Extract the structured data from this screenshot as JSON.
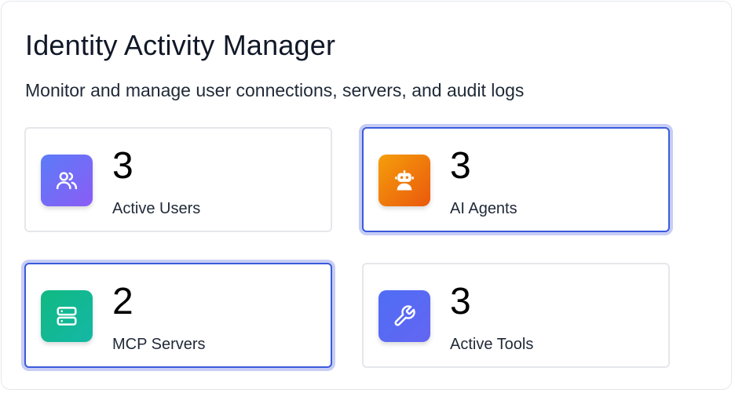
{
  "header": {
    "title": "Identity Activity Manager",
    "subtitle": "Monitor and manage user connections, servers, and audit logs"
  },
  "stats": [
    {
      "count": "3",
      "label": "Active Users",
      "icon": "users-icon",
      "selected": false
    },
    {
      "count": "3",
      "label": "AI Agents",
      "icon": "robot-icon",
      "selected": true
    },
    {
      "count": "2",
      "label": "MCP Servers",
      "icon": "server-icon",
      "selected": true
    },
    {
      "count": "3",
      "label": "Active Tools",
      "icon": "wrench-icon",
      "selected": false
    }
  ],
  "colors": {
    "selected_border": "#3b5bdb",
    "selected_ring": "#c7cdf5",
    "users_tile": "#6d6cf5",
    "agents_tile": "#f08a0c",
    "servers_tile": "#12b89a",
    "tools_tile": "#5a6af5"
  }
}
